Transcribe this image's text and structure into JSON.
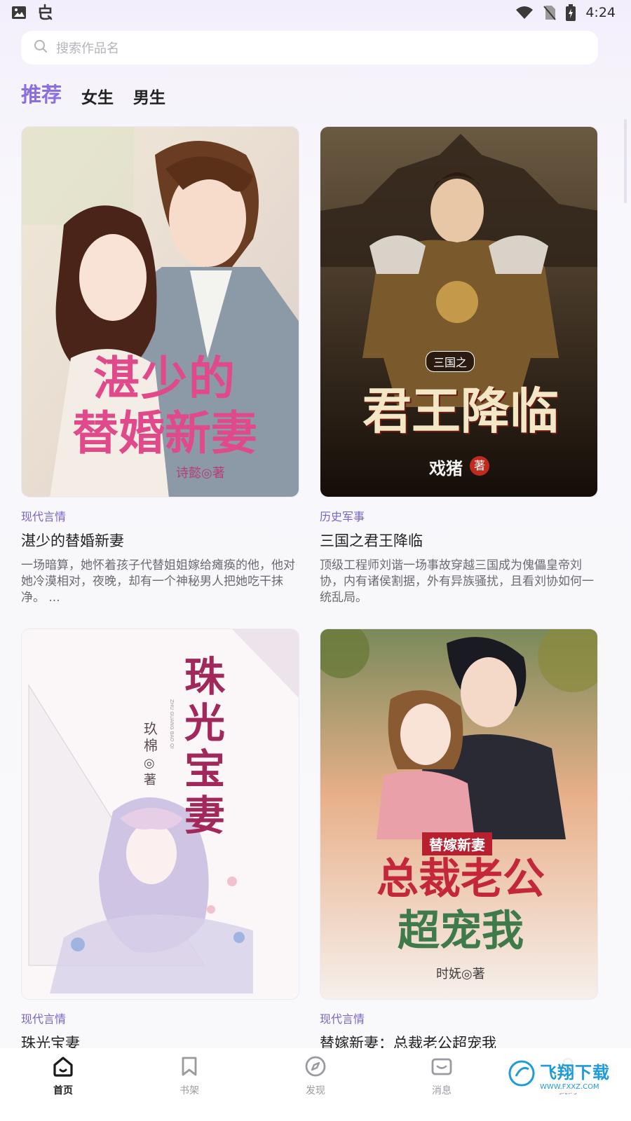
{
  "status_bar": {
    "time": "4:24",
    "left_icons": [
      "image-icon",
      "bug-app-icon"
    ],
    "right_icons": [
      "wifi-icon",
      "no-sim-icon",
      "battery-charging-icon"
    ]
  },
  "search": {
    "placeholder": "搜索作品名",
    "icon": "search-icon"
  },
  "tabs": [
    {
      "label": "推荐",
      "active": true
    },
    {
      "label": "女生",
      "active": false
    },
    {
      "label": "男生",
      "active": false
    }
  ],
  "books": [
    {
      "genre": "现代言情",
      "title": "湛少的替婚新妻",
      "desc": "一场暗算，她怀着孩子代替姐姐嫁给瘫痪的他，他对她冷漠相对，夜晚，却有一个神秘男人把她吃干抹净。 ...",
      "cover_title": [
        "湛少的",
        "替婚新妻"
      ],
      "cover_author": "诗懿◎著"
    },
    {
      "genre": "历史军事",
      "title": "三国之君王降临",
      "desc": "顶级工程师刘谐一场事故穿越三国成为傀儡皇帝刘协，内有诸侯割据，外有异族骚扰，且看刘协如何一统乱局。",
      "cover_tag": "三国之",
      "cover_title": [
        "君王降临"
      ],
      "cover_author": "戏猪",
      "cover_author_mark": "著"
    },
    {
      "genre": "现代言情",
      "title": "珠光宝妻",
      "desc": "",
      "cover_title": [
        "珠光",
        "宝妻"
      ],
      "cover_author": "玖棉",
      "cover_author_mark": "◎著",
      "cover_pinyin": "ZHU GUANG BAO QI"
    },
    {
      "genre": "现代言情",
      "title": "替嫁新妻：总裁老公超宠我",
      "desc": "",
      "cover_tag": "替嫁新妻",
      "cover_title": [
        "总裁老公",
        "超宠我"
      ],
      "cover_author": "时妩◎著"
    }
  ],
  "bottom_nav": [
    {
      "label": "首页",
      "icon": "home-icon",
      "active": true
    },
    {
      "label": "书架",
      "icon": "bookmark-icon",
      "active": false
    },
    {
      "label": "发现",
      "icon": "compass-icon",
      "active": false
    },
    {
      "label": "消息",
      "icon": "message-icon",
      "active": false
    },
    {
      "label": "我的",
      "icon": "profile-icon",
      "active": false
    }
  ],
  "watermark": {
    "main": "飞翔下载",
    "sub": "WWW.FXXZ.COM"
  },
  "colors": {
    "accent": "#8b6fe0",
    "genre": "#7a63c8",
    "text": "#222222",
    "muted": "#6a6a70"
  }
}
